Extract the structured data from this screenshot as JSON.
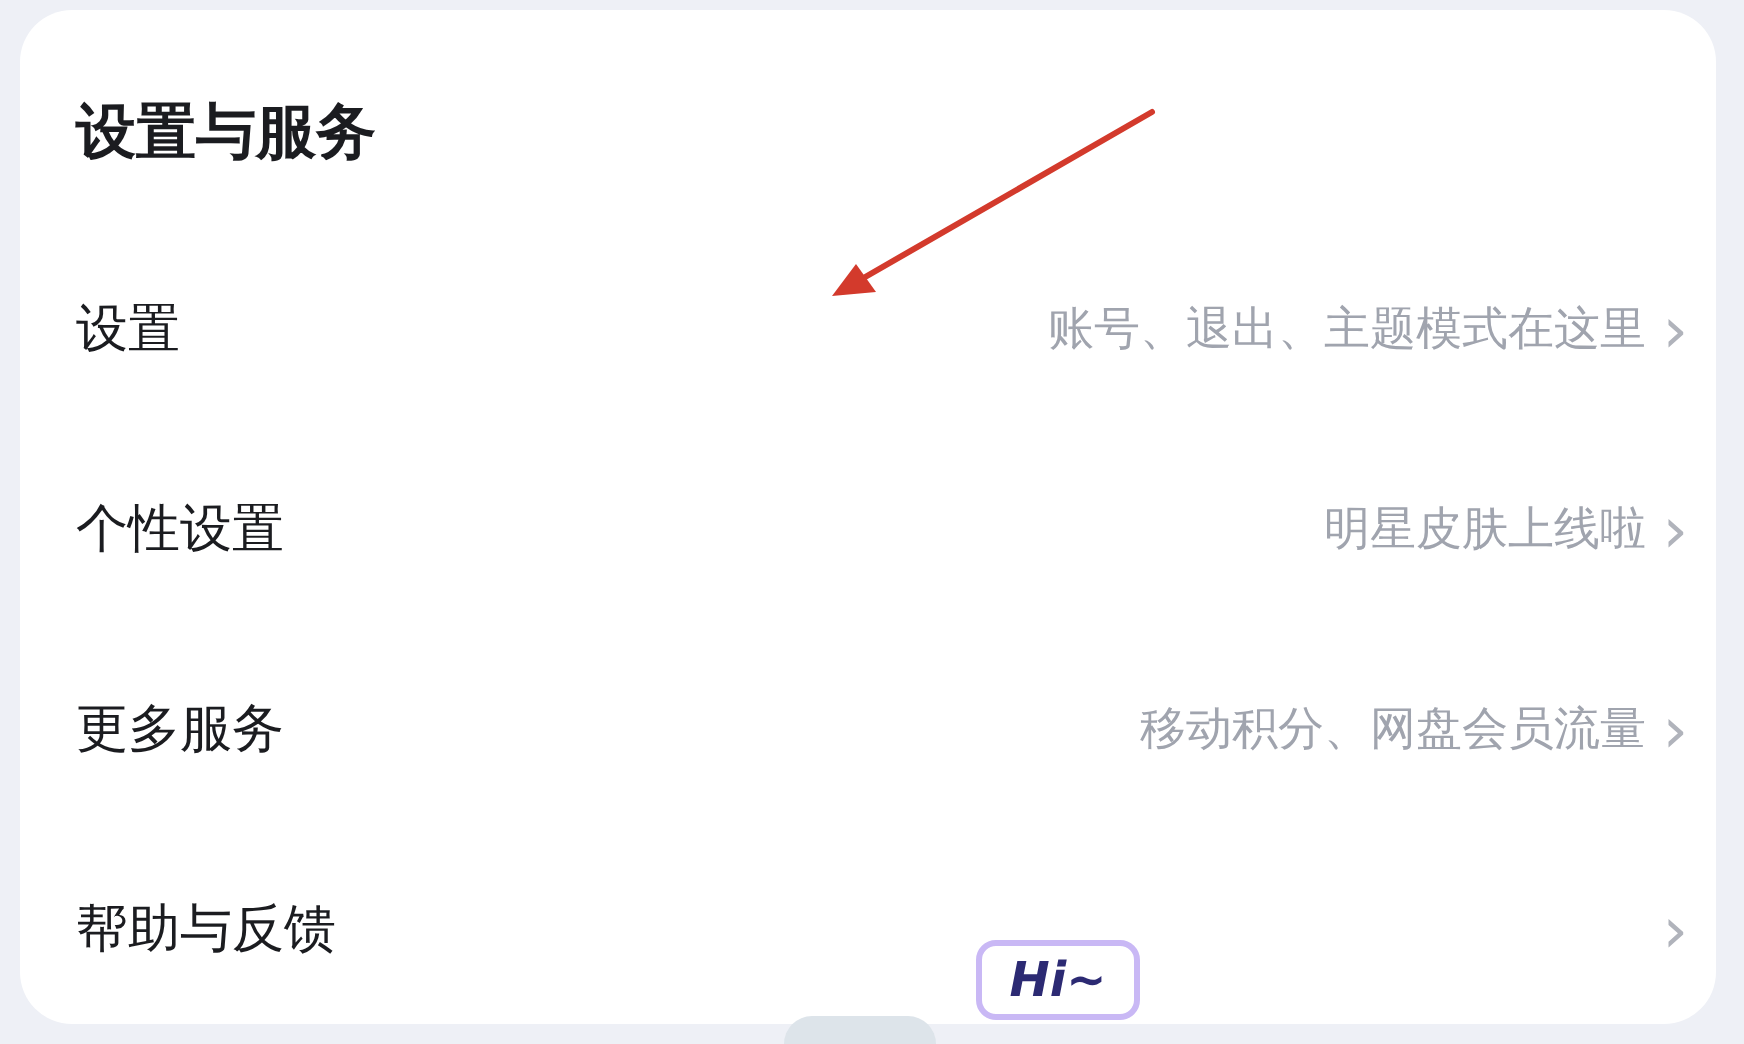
{
  "section": {
    "title": "设置与服务"
  },
  "items": [
    {
      "label": "设置",
      "hint": "账号、退出、主题模式在这里",
      "chevron": "›"
    },
    {
      "label": "个性设置",
      "hint": "明星皮肤上线啦",
      "chevron": "›"
    },
    {
      "label": "更多服务",
      "hint": "移动积分、网盘会员流量",
      "chevron": "›"
    },
    {
      "label": "帮助与反馈",
      "chevron": "›"
    }
  ],
  "sticker": {
    "text": "Hi~"
  }
}
